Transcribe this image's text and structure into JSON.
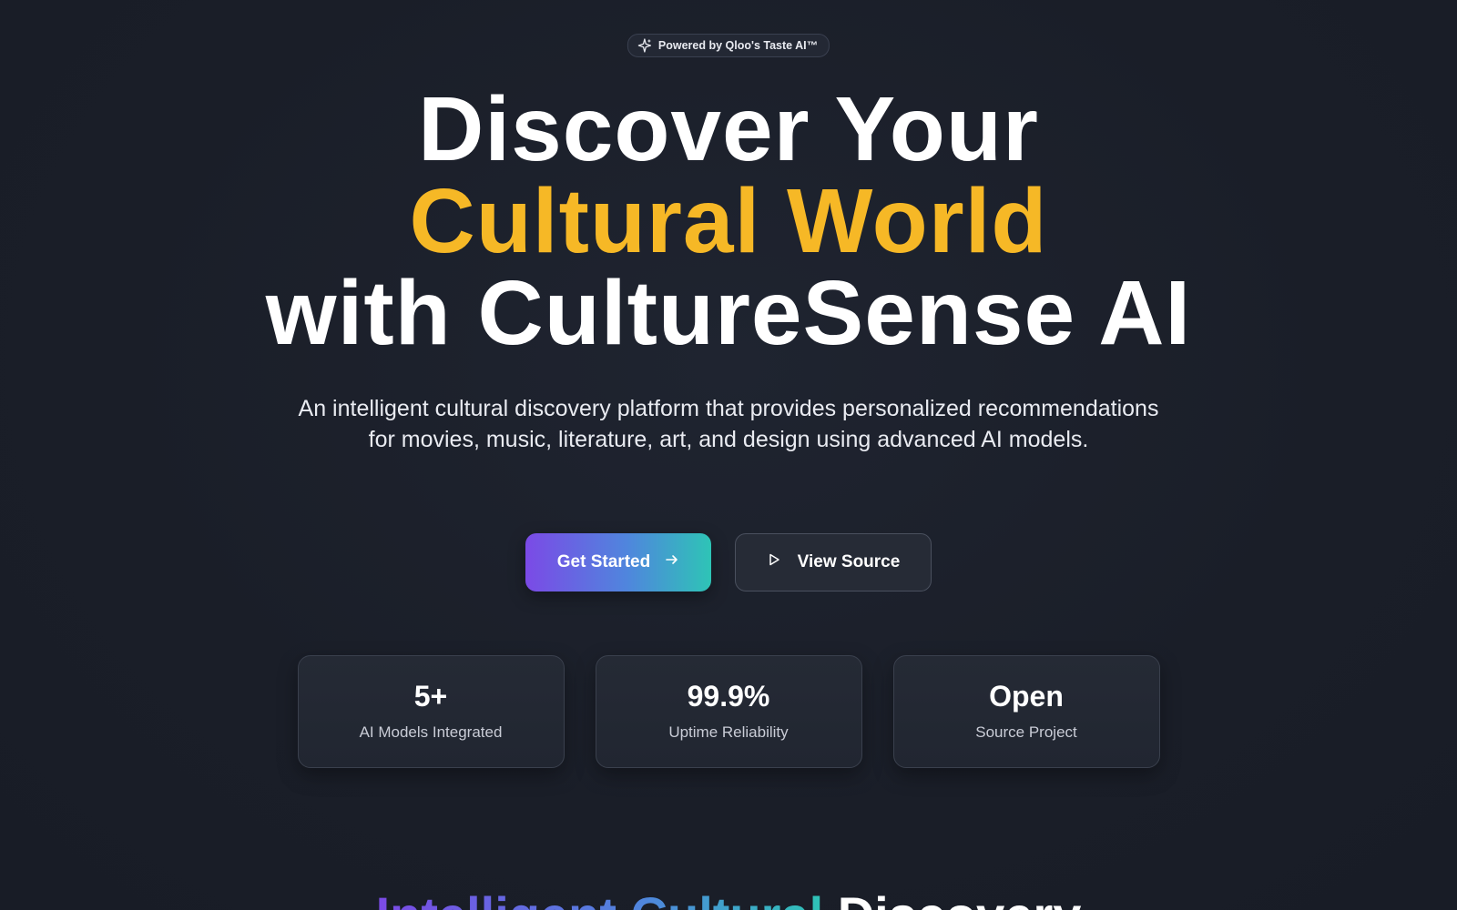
{
  "badge": {
    "icon": "sparkle-icon",
    "text": "Powered by Qloo's Taste AI™"
  },
  "hero": {
    "line1": "Discover Your",
    "line2": "Cultural World",
    "line3": "with CultureSense AI",
    "accent_color": "#f6b826",
    "subtitle": "An intelligent cultural discovery platform that provides personalized recommendations for movies, music, literature, art, and design using advanced AI models."
  },
  "cta": {
    "primary_label": "Get Started",
    "primary_icon": "arrow-right-icon",
    "secondary_label": "View Source",
    "secondary_icon": "play-icon"
  },
  "stats": [
    {
      "value": "5+",
      "label": "AI Models Integrated"
    },
    {
      "value": "99.9%",
      "label": "Uptime Reliability"
    },
    {
      "value": "Open",
      "label": "Source Project"
    }
  ],
  "section": {
    "heading_gradient": "Intelligent Cultural",
    "heading_plain": "Discovery"
  },
  "colors": {
    "background": "#1b1f2a",
    "gradient_start": "#7b4ae6",
    "gradient_end": "#2ec4b6"
  }
}
